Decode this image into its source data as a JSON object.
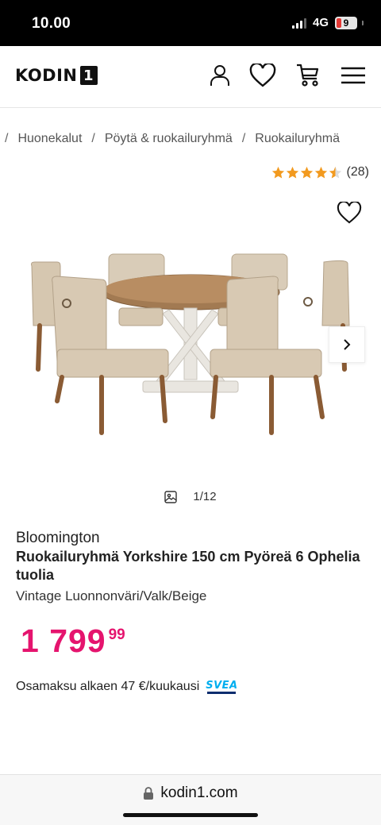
{
  "status_bar": {
    "time": "10.00",
    "network": "4G",
    "battery": "9"
  },
  "header": {
    "logo_text": "KODIN",
    "logo_number": "1",
    "icons": [
      "user-icon",
      "heart-icon",
      "cart-icon",
      "menu-icon"
    ]
  },
  "breadcrumb": [
    {
      "label": "Huonekalut"
    },
    {
      "label": "Pöytä & ruokailuryhmä"
    },
    {
      "label": "Ruokailuryhmä"
    }
  ],
  "rating": {
    "stars": 4.5,
    "count": "(28)"
  },
  "gallery": {
    "counter": "1/12"
  },
  "product": {
    "brand": "Bloomington",
    "title": "Ruokailuryhmä Yorkshire 150 cm Pyöreä 6 Ophelia tuolia",
    "variant": "Vintage Luonnonväri/Valk/Beige",
    "price_main": "1 799",
    "price_cents": "99",
    "installment": "Osamaksu alkaen 47 €/kuukausi",
    "financing_logo": "SVEA"
  },
  "browser": {
    "url": "kodin1.com"
  },
  "colors": {
    "price": "#e5146e",
    "star": "#f29a1f",
    "svea_blue": "#00aeef"
  }
}
